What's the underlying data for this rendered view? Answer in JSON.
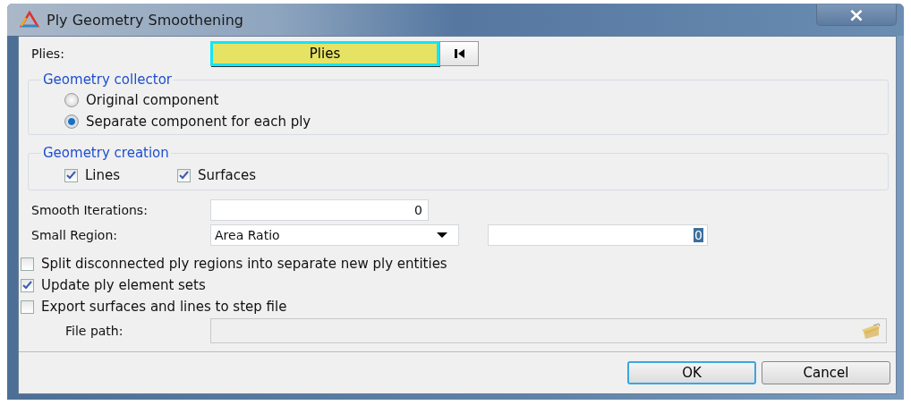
{
  "window": {
    "title": "Ply Geometry Smoothening",
    "close": "×"
  },
  "plies": {
    "label": "Plies:",
    "selector": "Plies"
  },
  "geometry_collector": {
    "title": "Geometry collector",
    "options": [
      {
        "label": "Original component",
        "selected": false
      },
      {
        "label": "Separate component for each ply",
        "selected": true
      }
    ]
  },
  "geometry_creation": {
    "title": "Geometry creation",
    "options": [
      {
        "label": "Lines",
        "checked": true
      },
      {
        "label": "Surfaces",
        "checked": true
      }
    ]
  },
  "smooth_iterations": {
    "label": "Smooth Iterations:",
    "value": "0"
  },
  "small_region": {
    "label": "Small Region:",
    "value": "Area Ratio",
    "ratio_value": "0"
  },
  "options": [
    {
      "label": "Split disconnected ply regions into separate new ply entities",
      "checked": false
    },
    {
      "label": "Update ply element sets",
      "checked": true
    },
    {
      "label": "Export surfaces and lines to step file",
      "checked": false
    }
  ],
  "file_path": {
    "label": "File path:",
    "disabled": true
  },
  "buttons": [
    {
      "label": "OK",
      "focused": true
    },
    {
      "label": "Cancel",
      "focused": false
    }
  ]
}
